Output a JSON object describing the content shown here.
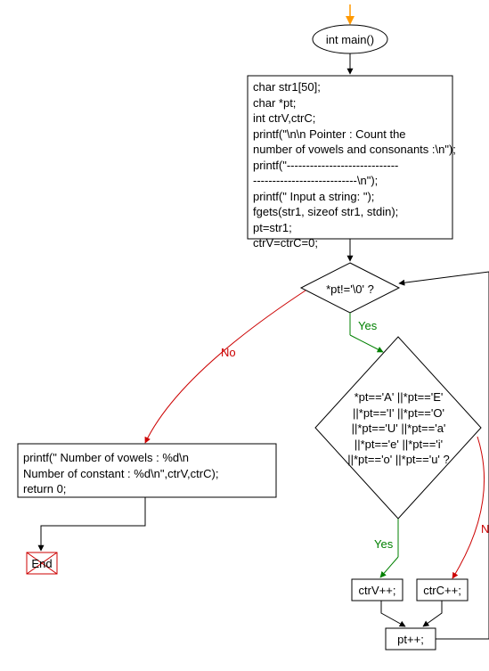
{
  "start": {
    "label": "int main()"
  },
  "init_block": {
    "lines": "char str1[50];\nchar *pt;\nint ctrV,ctrC;\nprintf(\"\\n\\n Pointer : Count the\nnumber of vowels and consonants :\\n\");\nprintf(\"-----------------------------\n---------------------------\\n\");\nprintf(\" Input a string: \");\nfgets(str1, sizeof str1, stdin);\npt=str1;\nctrV=ctrC=0;"
  },
  "cond1": {
    "label": "*pt!='\\0' ?"
  },
  "cond2": {
    "label": "*pt=='A' ||*pt=='E'\n||*pt=='I' ||*pt=='O'\n||*pt=='U' ||*pt=='a'\n||*pt=='e' ||*pt=='i'\n||*pt=='o' ||*pt=='u' ?"
  },
  "ctrV": {
    "label": "ctrV++;"
  },
  "ctrC": {
    "label": "ctrC++;"
  },
  "ptpp": {
    "label": "pt++;"
  },
  "output": {
    "label": "printf(\" Number of vowels : %d\\n\nNumber of constant : %d\\n\",ctrV,ctrC);\nreturn 0;"
  },
  "end": {
    "label": "End"
  },
  "labels": {
    "yes": "Yes",
    "no": "No",
    "no_cut": "N"
  }
}
